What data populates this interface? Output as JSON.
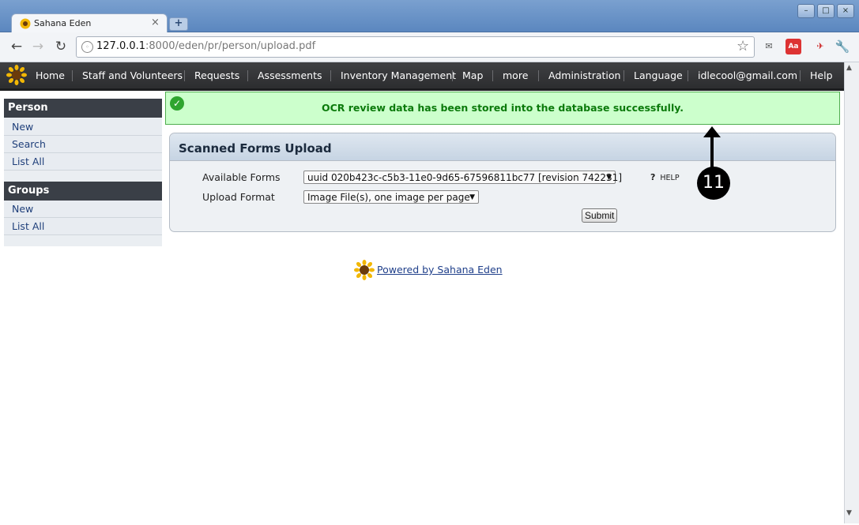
{
  "browser": {
    "tab_title": "Sahana Eden",
    "tab_close": "×",
    "new_tab": "+",
    "url_host": "127.0.0.1",
    "url_path": ":8000/eden/pr/person/upload.pdf",
    "window_buttons": {
      "minimize": "–",
      "maximize": "□",
      "close": "×"
    }
  },
  "menu": {
    "items": [
      "Home",
      "Staff and Volunteers",
      "Requests",
      "Assessments",
      "Inventory Management",
      "Map",
      "more",
      "Administration",
      "Language",
      "idlecool@gmail.com",
      "Help"
    ]
  },
  "sidebar": {
    "person": {
      "title": "Person",
      "items": [
        "New",
        "Search",
        "List All"
      ]
    },
    "groups": {
      "title": "Groups",
      "items": [
        "New",
        "List All"
      ]
    }
  },
  "confirmation": {
    "message": "OCR review data has been stored into the database successfully."
  },
  "panel": {
    "title": "Scanned Forms Upload",
    "available_forms_label": "Available Forms",
    "available_forms_value": "uuid 020b423c-c5b3-11e0-9d65-67596811bc77 [revision 742231]",
    "upload_format_label": "Upload Format",
    "upload_format_value": "Image File(s), one image per page",
    "help_label": "HELP",
    "help_mark": "?",
    "submit_label": "Submit"
  },
  "footer": {
    "link_text": "Powered by Sahana Eden"
  },
  "annotation": {
    "label": "11"
  },
  "colors": {
    "menubar": "#2c2d2f",
    "success_bg": "#ccffcc",
    "success_text": "#0b7a0b",
    "link": "#1f3f8a"
  }
}
